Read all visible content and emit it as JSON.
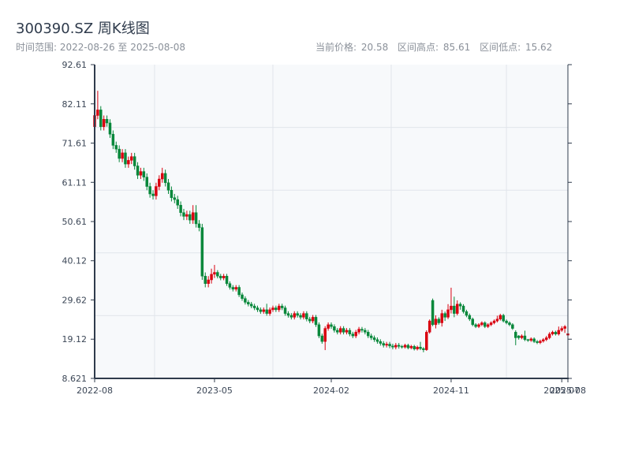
{
  "header": {
    "title": "300390.SZ 周K线图",
    "range_label": "时间范围: 2022-08-26 至 2025-08-08",
    "current_price": "当前价格: 20.58",
    "range_high": "区间高点: 85.61",
    "range_low": "区间低点: 15.62"
  },
  "colors": {
    "up": "#d9000f",
    "down": "#07873a",
    "plot_bg": "#f7f9fb",
    "axis": "#2f3b4c",
    "grid": "#e1e5eb"
  },
  "chart_data": {
    "type": "candlestick",
    "title": "300390.SZ 周K线图",
    "ylim": [
      8.621,
      92.61
    ],
    "y_ticks": [
      "92.61",
      "82.11",
      "71.61",
      "61.11",
      "50.61",
      "40.12",
      "29.62",
      "19.12",
      "8.621"
    ],
    "x_ticks": [
      {
        "label": "2022-08",
        "index": 0
      },
      {
        "label": "2023-05",
        "index": 39
      },
      {
        "label": "2024-02",
        "index": 77
      },
      {
        "label": "2024-11",
        "index": 116
      },
      {
        "label": "2025-07",
        "index": 152
      },
      {
        "label": "2025-08",
        "index": 154
      }
    ],
    "grid": true,
    "columns": [
      "date",
      "open",
      "close",
      "low",
      "high"
    ],
    "candles": [
      [
        "2022-08-26",
        76,
        79,
        75,
        80
      ],
      [
        "2022-09-02",
        79,
        80.5,
        78,
        85.61
      ],
      [
        "2022-09-09",
        80.5,
        76,
        75,
        81.5
      ],
      [
        "2022-09-16",
        76,
        78,
        75,
        79
      ],
      [
        "2022-09-23",
        78,
        77,
        76,
        79
      ],
      [
        "2022-09-30",
        77,
        74,
        73,
        78
      ],
      [
        "2022-10-07",
        74,
        71,
        70,
        75
      ],
      [
        "2022-10-14",
        71,
        70,
        69,
        72
      ],
      [
        "2022-10-21",
        70,
        67.5,
        66.5,
        71
      ],
      [
        "2022-10-28",
        67.5,
        69,
        66.5,
        70
      ],
      [
        "2022-11-04",
        69,
        66,
        65,
        70
      ],
      [
        "2022-11-11",
        66,
        67,
        65,
        68
      ],
      [
        "2022-11-18",
        67,
        68,
        66,
        69
      ],
      [
        "2022-11-25",
        68,
        65.5,
        64.5,
        69
      ],
      [
        "2022-12-02",
        65.5,
        63,
        62,
        66.5
      ],
      [
        "2022-12-09",
        63,
        64,
        62,
        65
      ],
      [
        "2022-12-16",
        64,
        62.5,
        61.5,
        65
      ],
      [
        "2022-12-23",
        62.5,
        60,
        59,
        63.5
      ],
      [
        "2022-12-30",
        60,
        58,
        57,
        61
      ],
      [
        "2023-01-06",
        58,
        57.5,
        56.5,
        59
      ],
      [
        "2023-01-13",
        57.5,
        60,
        56.5,
        61
      ],
      [
        "2023-01-20",
        60,
        62,
        59,
        63
      ],
      [
        "2023-01-27",
        62,
        63.5,
        61,
        65
      ],
      [
        "2023-02-03",
        63.5,
        61,
        60,
        64.5
      ],
      [
        "2023-02-10",
        61,
        59,
        58,
        62
      ],
      [
        "2023-02-17",
        59,
        57,
        56,
        60
      ],
      [
        "2023-02-24",
        57,
        56.5,
        55.5,
        58
      ],
      [
        "2023-03-03",
        56.5,
        55,
        54,
        57.5
      ],
      [
        "2023-03-10",
        55,
        53,
        52,
        56
      ],
      [
        "2023-03-17",
        53,
        52,
        51,
        54
      ],
      [
        "2023-03-24",
        52,
        52.5,
        51,
        53.5
      ],
      [
        "2023-03-31",
        52.5,
        51,
        50,
        53.5
      ],
      [
        "2023-04-07",
        51,
        53,
        50,
        55
      ],
      [
        "2023-04-14",
        53,
        50,
        49,
        55
      ],
      [
        "2023-04-21",
        50,
        49,
        48,
        51
      ],
      [
        "2023-04-28",
        49,
        36,
        35,
        50
      ],
      [
        "2023-05-05",
        36,
        34,
        33,
        37
      ],
      [
        "2023-05-12",
        34,
        35,
        33,
        36
      ],
      [
        "2023-05-19",
        35,
        36.5,
        34,
        38
      ],
      [
        "2023-05-26",
        36.5,
        37,
        35.5,
        39
      ],
      [
        "2023-06-02",
        37,
        36,
        35.4,
        37.6
      ],
      [
        "2023-06-09",
        36,
        35.5,
        34.9,
        36.6
      ],
      [
        "2023-06-16",
        35.5,
        36,
        34.9,
        36.6
      ],
      [
        "2023-06-23",
        36,
        34,
        33.4,
        36.6
      ],
      [
        "2023-06-30",
        34,
        33,
        32.4,
        34.6
      ],
      [
        "2023-07-07",
        33,
        32.5,
        31.9,
        33.6
      ],
      [
        "2023-07-14",
        32.5,
        33,
        31.9,
        33.6
      ],
      [
        "2023-07-21",
        33,
        31,
        30.4,
        33.6
      ],
      [
        "2023-07-28",
        31,
        30,
        29.4,
        31.6
      ],
      [
        "2023-08-04",
        30,
        29,
        28.4,
        30.6
      ],
      [
        "2023-08-11",
        29,
        28.5,
        27.9,
        29.6
      ],
      [
        "2023-08-18",
        28.5,
        28,
        27.4,
        29.1
      ],
      [
        "2023-08-25",
        28,
        27.5,
        26.9,
        28.6
      ],
      [
        "2023-09-01",
        27.5,
        27,
        26.4,
        28.1
      ],
      [
        "2023-09-08",
        27,
        26.5,
        25.9,
        27.6
      ],
      [
        "2023-09-15",
        26.5,
        27,
        25.9,
        27.6
      ],
      [
        "2023-09-22",
        27,
        26,
        25.4,
        28.6
      ],
      [
        "2023-09-29",
        26,
        27,
        25.4,
        27.6
      ],
      [
        "2023-10-06",
        27,
        27.5,
        26.4,
        28.1
      ],
      [
        "2023-10-13",
        27.5,
        27,
        26.4,
        28.1
      ],
      [
        "2023-10-20",
        27,
        28,
        26.4,
        28.6
      ],
      [
        "2023-10-27",
        28,
        27.5,
        26.9,
        28.6
      ],
      [
        "2023-11-03",
        27.5,
        26,
        25.4,
        28.1
      ],
      [
        "2023-11-10",
        26,
        25.5,
        24.9,
        26.6
      ],
      [
        "2023-11-17",
        25.5,
        25,
        24.4,
        26.1
      ],
      [
        "2023-11-24",
        25,
        26,
        24.4,
        26.6
      ],
      [
        "2023-12-01",
        26,
        25.5,
        24.9,
        26.6
      ],
      [
        "2023-12-08",
        25.5,
        25,
        24.4,
        26.1
      ],
      [
        "2023-12-15",
        25,
        26,
        24.4,
        26.6
      ],
      [
        "2023-12-22",
        26,
        24.5,
        23.9,
        26.6
      ],
      [
        "2023-12-29",
        24.5,
        24,
        23.4,
        25.1
      ],
      [
        "2024-01-05",
        24,
        25,
        23.4,
        25.6
      ],
      [
        "2024-01-12",
        25,
        23,
        22.4,
        25.6
      ],
      [
        "2024-01-19",
        23,
        20,
        19.4,
        23.6
      ],
      [
        "2024-01-26",
        20,
        18.5,
        17.9,
        20.6
      ],
      [
        "2024-02-02",
        18.5,
        22,
        16.2,
        22.6
      ],
      [
        "2024-02-09",
        22,
        23,
        21.4,
        23.6
      ],
      [
        "2024-02-16",
        23,
        22.5,
        21.9,
        23.6
      ],
      [
        "2024-02-23",
        22.5,
        21.5,
        20.9,
        23.1
      ],
      [
        "2024-03-01",
        21.5,
        21,
        20.4,
        22.1
      ],
      [
        "2024-03-08",
        21,
        22,
        20.4,
        22.6
      ],
      [
        "2024-03-15",
        22,
        21,
        20.4,
        22.6
      ],
      [
        "2024-03-22",
        21,
        21.5,
        20.4,
        22.1
      ],
      [
        "2024-03-29",
        21.5,
        20.5,
        19.9,
        22.1
      ],
      [
        "2024-04-05",
        20.5,
        20,
        19.4,
        21.1
      ],
      [
        "2024-04-12",
        20,
        21,
        19.4,
        21.6
      ],
      [
        "2024-04-19",
        21,
        21.8,
        20.4,
        22.4
      ],
      [
        "2024-04-26",
        21.8,
        21.5,
        20.9,
        22.4
      ],
      [
        "2024-05-03",
        21.5,
        21,
        20.4,
        22.1
      ],
      [
        "2024-05-10",
        21,
        20,
        19.4,
        21.6
      ],
      [
        "2024-05-17",
        20,
        19.5,
        18.9,
        20.6
      ],
      [
        "2024-05-24",
        19.5,
        19,
        18.4,
        20.1
      ],
      [
        "2024-05-31",
        19,
        18.5,
        17.9,
        19.6
      ],
      [
        "2024-06-07",
        18.5,
        18,
        17.4,
        19.1
      ],
      [
        "2024-06-14",
        18,
        17.5,
        16.9,
        18.6
      ],
      [
        "2024-06-21",
        17.5,
        17.8,
        16.9,
        18.4
      ],
      [
        "2024-06-28",
        17.8,
        17.3,
        16.7,
        18.4
      ],
      [
        "2024-07-05",
        17.3,
        17,
        16.4,
        17.9
      ],
      [
        "2024-07-12",
        17,
        17.5,
        16.4,
        18.1
      ],
      [
        "2024-07-19",
        17.5,
        17.2,
        16.6,
        18.1
      ],
      [
        "2024-07-26",
        17.2,
        17,
        16.6,
        17.6
      ],
      [
        "2024-08-02",
        17,
        17.5,
        16.6,
        17.9
      ],
      [
        "2024-08-09",
        17.5,
        16.8,
        16.4,
        17.9
      ],
      [
        "2024-08-16",
        16.8,
        17.2,
        16.4,
        17.6
      ],
      [
        "2024-08-23",
        17.2,
        16.5,
        16.1,
        17.6
      ],
      [
        "2024-08-30",
        16.5,
        17,
        16.1,
        17.4
      ],
      [
        "2024-09-06",
        17,
        16.6,
        16.2,
        18.4
      ],
      [
        "2024-09-13",
        16.6,
        16.3,
        15.62,
        17
      ],
      [
        "2024-09-20",
        16.3,
        21,
        16,
        21.5
      ],
      [
        "2024-09-27",
        21,
        24,
        20.6,
        24.4
      ],
      [
        "2024-10-04",
        29.5,
        23,
        22.6,
        30
      ],
      [
        "2024-10-11",
        23,
        24.5,
        22,
        25.5
      ],
      [
        "2024-10-18",
        24.5,
        23.5,
        23,
        25
      ],
      [
        "2024-10-25",
        23.5,
        26,
        22.5,
        27
      ],
      [
        "2024-11-01",
        26,
        25,
        24,
        26.5
      ],
      [
        "2024-11-08",
        25,
        27,
        24.5,
        28.5
      ],
      [
        "2024-11-15",
        27,
        28,
        26,
        32.9
      ],
      [
        "2024-11-22",
        28,
        26,
        25,
        30.5
      ],
      [
        "2024-11-29",
        26,
        28.5,
        25.5,
        29.5
      ],
      [
        "2024-12-06",
        28.5,
        28,
        27,
        29
      ],
      [
        "2024-12-13",
        28,
        26.5,
        26,
        28.5
      ],
      [
        "2024-12-20",
        26.5,
        25.5,
        25,
        27
      ],
      [
        "2024-12-27",
        25.5,
        24.5,
        24,
        26
      ],
      [
        "2025-01-03",
        24.5,
        23,
        22.6,
        24.9
      ],
      [
        "2025-01-10",
        23,
        22.5,
        22.1,
        23.4
      ],
      [
        "2025-01-17",
        22.5,
        23,
        22.1,
        23.4
      ],
      [
        "2025-01-24",
        23,
        23.5,
        22.6,
        23.9
      ],
      [
        "2025-01-31",
        23.5,
        22.5,
        22.1,
        23.9
      ],
      [
        "2025-02-07",
        22.5,
        23,
        22.1,
        23.4
      ],
      [
        "2025-02-14",
        23,
        23.5,
        22.6,
        23.9
      ],
      [
        "2025-02-21",
        23.5,
        24,
        23.1,
        24.4
      ],
      [
        "2025-02-28",
        24,
        24.5,
        23.6,
        25.4
      ],
      [
        "2025-03-07",
        24.5,
        25.5,
        24.1,
        25.9
      ],
      [
        "2025-03-14",
        25.5,
        24,
        23.6,
        25.9
      ],
      [
        "2025-03-21",
        24,
        23.5,
        23.1,
        24.4
      ],
      [
        "2025-03-28",
        23.5,
        23,
        22.6,
        23.9
      ],
      [
        "2025-04-04",
        23,
        22,
        21.6,
        23.4
      ],
      [
        "2025-04-11",
        21,
        19.5,
        17.5,
        21.5
      ],
      [
        "2025-04-18",
        20,
        19.5,
        19,
        20.2
      ],
      [
        "2025-04-25",
        19.5,
        20,
        19.1,
        20.4
      ],
      [
        "2025-05-02",
        20,
        19,
        18.6,
        21.4
      ],
      [
        "2025-05-09",
        19,
        18.8,
        18.4,
        19.2
      ],
      [
        "2025-05-16",
        18.8,
        19.2,
        18.4,
        19.6
      ],
      [
        "2025-05-23",
        19.2,
        18.5,
        18.1,
        19.6
      ],
      [
        "2025-05-30",
        18.5,
        18.2,
        17.8,
        18.9
      ],
      [
        "2025-06-06",
        18.2,
        18.6,
        17.8,
        19
      ],
      [
        "2025-06-13",
        18.6,
        19,
        18.2,
        19.4
      ],
      [
        "2025-06-20",
        19,
        19.5,
        18.6,
        20
      ],
      [
        "2025-06-27",
        19.5,
        20.5,
        19.1,
        21
      ],
      [
        "2025-07-04",
        20.5,
        21,
        20.1,
        21.4
      ],
      [
        "2025-07-11",
        21,
        20.5,
        20.1,
        21.4
      ],
      [
        "2025-07-18",
        20.5,
        21.5,
        20.1,
        22.5
      ],
      [
        "2025-07-25",
        21.5,
        22,
        21.1,
        22.6
      ],
      [
        "2025-08-01",
        22,
        22.5,
        20.8,
        22.9
      ],
      [
        "2025-08-08",
        20.2,
        20.58,
        19.9,
        21.5
      ]
    ]
  }
}
